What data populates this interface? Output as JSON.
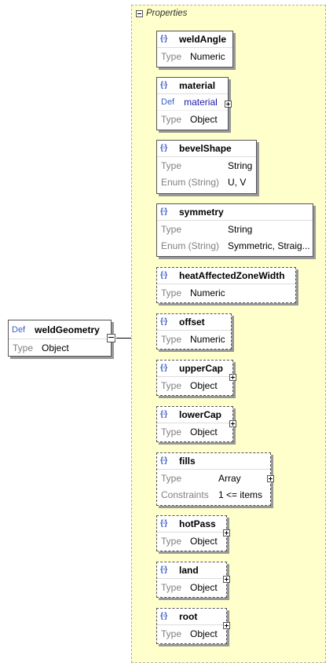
{
  "root": {
    "def_label": "Def",
    "name": "weldGeometry",
    "type_label": "Type",
    "type_value": "Object"
  },
  "properties_group": {
    "title": "Properties"
  },
  "element_icon_glyph": "{▫}",
  "properties": [
    {
      "name": "weldAngle",
      "rows": [
        {
          "label": "Type",
          "value": "Numeric"
        }
      ]
    },
    {
      "name": "material",
      "rows": [
        {
          "label": "Def",
          "value": "material",
          "is_def": true
        },
        {
          "label": "Type",
          "value": "Object"
        }
      ]
    },
    {
      "name": "bevelShape",
      "rows": [
        {
          "label": "Type",
          "value": "String"
        },
        {
          "label": "Enum (String)",
          "value": "U, V"
        }
      ]
    },
    {
      "name": "symmetry",
      "rows": [
        {
          "label": "Type",
          "value": "String"
        },
        {
          "label": "Enum (String)",
          "value": "Symmetric, Straig..."
        }
      ]
    },
    {
      "name": "heatAffectedZoneWidth",
      "rows": [
        {
          "label": "Type",
          "value": "Numeric"
        }
      ]
    },
    {
      "name": "offset",
      "rows": [
        {
          "label": "Type",
          "value": "Numeric"
        }
      ]
    },
    {
      "name": "upperCap",
      "rows": [
        {
          "label": "Type",
          "value": "Object"
        }
      ]
    },
    {
      "name": "lowerCap",
      "rows": [
        {
          "label": "Type",
          "value": "Object"
        }
      ]
    },
    {
      "name": "fills",
      "rows": [
        {
          "label": "Type",
          "value": "Array"
        },
        {
          "label": "Constraints",
          "value": "1 <= items"
        }
      ]
    },
    {
      "name": "hotPass",
      "rows": [
        {
          "label": "Type",
          "value": "Object"
        }
      ]
    },
    {
      "name": "land",
      "rows": [
        {
          "label": "Type",
          "value": "Object"
        }
      ]
    },
    {
      "name": "root",
      "rows": [
        {
          "label": "Type",
          "value": "Object"
        }
      ]
    }
  ]
}
